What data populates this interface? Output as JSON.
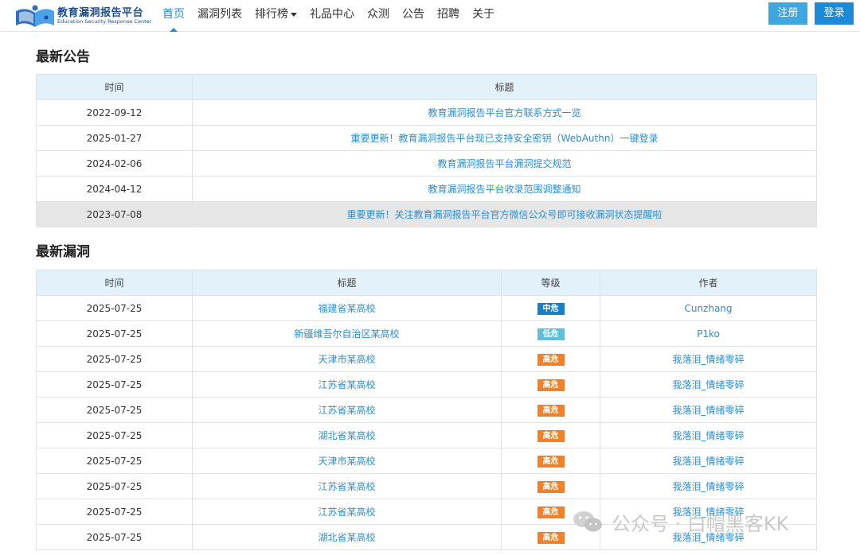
{
  "header": {
    "logo_title": "教育漏洞报告平台",
    "logo_subtitle": "Education Security Response Center",
    "nav": [
      {
        "label": "首页",
        "active": true,
        "dropdown": false
      },
      {
        "label": "漏洞列表",
        "active": false,
        "dropdown": false
      },
      {
        "label": "排行榜",
        "active": false,
        "dropdown": true
      },
      {
        "label": "礼品中心",
        "active": false,
        "dropdown": false
      },
      {
        "label": "众测",
        "active": false,
        "dropdown": false
      },
      {
        "label": "公告",
        "active": false,
        "dropdown": false
      },
      {
        "label": "招聘",
        "active": false,
        "dropdown": false
      },
      {
        "label": "关于",
        "active": false,
        "dropdown": false
      }
    ],
    "register_label": "注册",
    "login_label": "登录"
  },
  "announcements": {
    "title": "最新公告",
    "columns": [
      "时间",
      "标题"
    ],
    "rows": [
      {
        "date": "2022-09-12",
        "title": "教育漏洞报告平台官方联系方式一览",
        "highlighted": false
      },
      {
        "date": "2025-01-27",
        "title": "重要更新！教育漏洞报告平台现已支持安全密钥（WebAuthn）一键登录",
        "highlighted": false
      },
      {
        "date": "2024-02-06",
        "title": "教育漏洞报告平台漏洞提交规范",
        "highlighted": false
      },
      {
        "date": "2024-04-12",
        "title": "教育漏洞报告平台收录范围调整通知",
        "highlighted": false
      },
      {
        "date": "2023-07-08",
        "title": "重要更新！关注教育漏洞报告平台官方微信公众号即可接收漏洞状态提醒啦",
        "highlighted": true
      }
    ]
  },
  "vulnerabilities": {
    "title": "最新漏洞",
    "columns": [
      "时间",
      "标题",
      "等级",
      "作者"
    ],
    "level_colors": {
      "中危": "#1a7fc4",
      "低危": "#5bc0de",
      "高危": "#f0812a"
    },
    "rows": [
      {
        "date": "2025-07-25",
        "title": "福建省某高校",
        "level": "中危",
        "author": "Cunzhang"
      },
      {
        "date": "2025-07-25",
        "title": "新疆维吾尔自治区某高校",
        "level": "低危",
        "author": "P1ko"
      },
      {
        "date": "2025-07-25",
        "title": "天津市某高校",
        "level": "高危",
        "author": "我落泪_情绪零碎"
      },
      {
        "date": "2025-07-25",
        "title": "江苏省某高校",
        "level": "高危",
        "author": "我落泪_情绪零碎"
      },
      {
        "date": "2025-07-25",
        "title": "江苏省某高校",
        "level": "高危",
        "author": "我落泪_情绪零碎"
      },
      {
        "date": "2025-07-25",
        "title": "湖北省某高校",
        "level": "高危",
        "author": "我落泪_情绪零碎"
      },
      {
        "date": "2025-07-25",
        "title": "天津市某高校",
        "level": "高危",
        "author": "我落泪_情绪零碎"
      },
      {
        "date": "2025-07-25",
        "title": "江苏省某高校",
        "level": "高危",
        "author": "我落泪_情绪零碎"
      },
      {
        "date": "2025-07-25",
        "title": "江苏省某高校",
        "level": "高危",
        "author": "我落泪_情绪零碎"
      },
      {
        "date": "2025-07-25",
        "title": "湖北省某高校",
        "level": "高危",
        "author": "我落泪_情绪零碎"
      }
    ]
  },
  "watermark": {
    "text": "公众号 · 白帽黑客KK",
    "icon": "wechat-icon"
  }
}
